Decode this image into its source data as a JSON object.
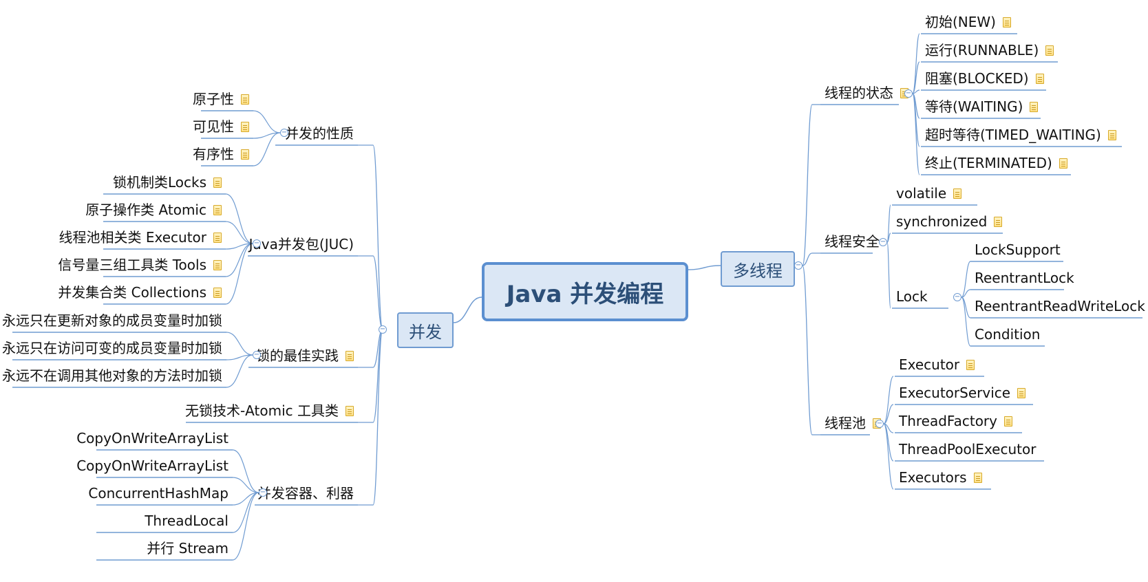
{
  "central": "Java 并发编程",
  "left": {
    "label": "并发",
    "groups": [
      {
        "label": "并发的性质",
        "note": false,
        "children": [
          {
            "label": "原子性",
            "note": true
          },
          {
            "label": "可见性",
            "note": true
          },
          {
            "label": "有序性",
            "note": true
          }
        ]
      },
      {
        "label": "Java并发包(JUC)",
        "note": false,
        "children": [
          {
            "label": "锁机制类Locks",
            "note": true
          },
          {
            "label": "原子操作类 Atomic",
            "note": true
          },
          {
            "label": "线程池相关类 Executor",
            "note": true
          },
          {
            "label": "信号量三组工具类 Tools",
            "note": true
          },
          {
            "label": "并发集合类 Collections",
            "note": true
          }
        ]
      },
      {
        "label": "锁的最佳实践",
        "note": true,
        "children": [
          {
            "label": "永远只在更新对象的成员变量时加锁",
            "note": false
          },
          {
            "label": "永远只在访问可变的成员变量时加锁",
            "note": false
          },
          {
            "label": "永远不在调用其他对象的方法时加锁",
            "note": false
          }
        ]
      },
      {
        "label": "无锁技术-Atomic 工具类",
        "note": true,
        "children": []
      },
      {
        "label": "并发容器、利器",
        "note": false,
        "children": [
          {
            "label": "CopyOnWriteArrayList",
            "note": false
          },
          {
            "label": "CopyOnWriteArrayList",
            "note": false
          },
          {
            "label": "ConcurrentHashMap",
            "note": false
          },
          {
            "label": "ThreadLocal",
            "note": false
          },
          {
            "label": "并行 Stream",
            "note": false
          }
        ]
      }
    ]
  },
  "right": {
    "label": "多线程",
    "groups": [
      {
        "label": "线程的状态",
        "note": true,
        "children": [
          {
            "label": "初始(NEW)",
            "note": true
          },
          {
            "label": "运行(RUNNABLE)",
            "note": true
          },
          {
            "label": "阻塞(BLOCKED)",
            "note": true
          },
          {
            "label": "等待(WAITING)",
            "note": true
          },
          {
            "label": "超时等待(TIMED_WAITING)",
            "note": true
          },
          {
            "label": "终止(TERMINATED)",
            "note": true
          }
        ]
      },
      {
        "label": "线程安全",
        "note": false,
        "children": [
          {
            "label": "volatile",
            "note": true
          },
          {
            "label": "synchronized",
            "note": true
          },
          {
            "label": "Lock",
            "note": false,
            "children": [
              {
                "label": "LockSupport",
                "note": false
              },
              {
                "label": "ReentrantLock",
                "note": false
              },
              {
                "label": "ReentrantReadWriteLock",
                "note": false
              },
              {
                "label": "Condition",
                "note": false
              }
            ]
          }
        ]
      },
      {
        "label": "线程池",
        "note": true,
        "children": [
          {
            "label": "Executor",
            "note": true
          },
          {
            "label": "ExecutorService",
            "note": true
          },
          {
            "label": "ThreadFactory",
            "note": true
          },
          {
            "label": "ThreadPoolExecutor",
            "note": false
          },
          {
            "label": "Executors",
            "note": true
          }
        ]
      }
    ]
  },
  "colors": {
    "line": "#6f9bd1",
    "node_fill": "#dbe7f5",
    "text_dark": "#2c4f78",
    "note": "#ffe28a"
  },
  "icons": {
    "note": "note-icon",
    "collapse": "collapse-toggle-icon"
  }
}
